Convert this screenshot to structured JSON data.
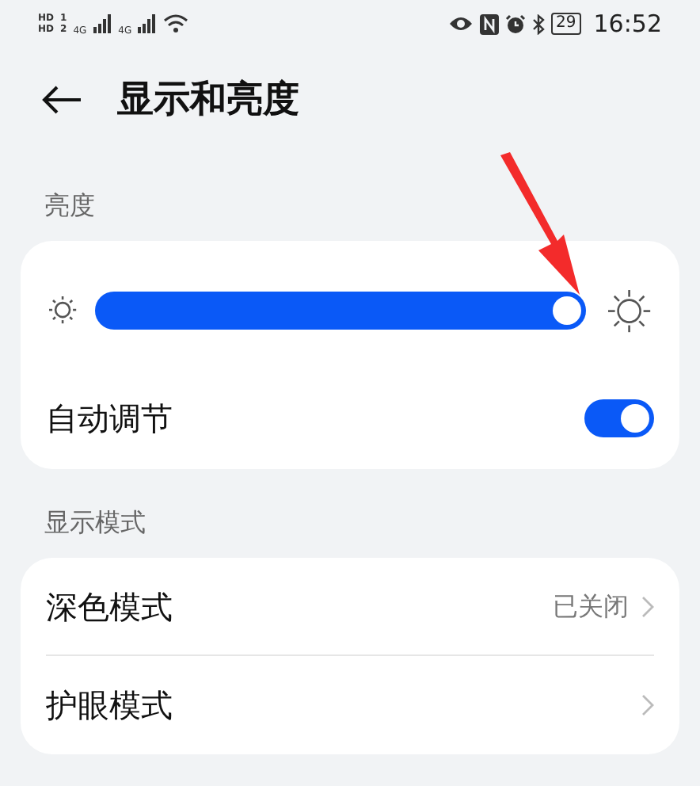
{
  "status_bar": {
    "sims": [
      {
        "badge": "HD",
        "slot": "1"
      },
      {
        "badge": "HD",
        "slot": "2"
      }
    ],
    "networks": [
      {
        "type": "4G"
      },
      {
        "type": "4G"
      }
    ],
    "battery": "29",
    "time": "16:52"
  },
  "header": {
    "title": "显示和亮度"
  },
  "sections": [
    {
      "title": "亮度",
      "rows": [
        {
          "kind": "slider",
          "level": 1
        },
        {
          "kind": "switch",
          "label": "自动调节",
          "on": true
        }
      ]
    },
    {
      "title": "显示模式",
      "rows": [
        {
          "kind": "link",
          "label": "深色模式",
          "value": "已关闭"
        },
        {
          "kind": "link",
          "label": "护眼模式"
        }
      ]
    }
  ]
}
